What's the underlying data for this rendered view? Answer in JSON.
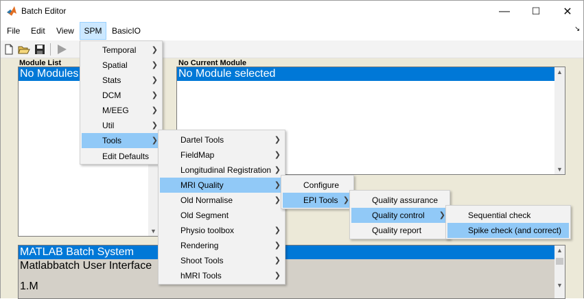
{
  "window": {
    "title": "Batch Editor",
    "controls": {
      "minimize": "—",
      "maximize": "☐",
      "close": "✕"
    }
  },
  "menubar": {
    "items": [
      "File",
      "Edit",
      "View",
      "SPM",
      "BasicIO"
    ],
    "active": "SPM",
    "corner_arrow": "↘"
  },
  "toolbar": {
    "icons": [
      "new-file-icon",
      "open-folder-icon",
      "save-icon",
      "run-icon"
    ]
  },
  "module_list": {
    "label": "Module List",
    "selected_text": "No Modules"
  },
  "current_module": {
    "label": "No Current Module",
    "selected_text": "No Module selected"
  },
  "bottom_panel": {
    "rows": [
      "MATLAB Batch System",
      "Matlabbatch User Interface",
      "1.M"
    ]
  },
  "spm_menu": {
    "items": [
      {
        "label": "Temporal",
        "submenu": true
      },
      {
        "label": "Spatial",
        "submenu": true
      },
      {
        "label": "Stats",
        "submenu": true
      },
      {
        "label": "DCM",
        "submenu": true
      },
      {
        "label": "M/EEG",
        "submenu": true
      },
      {
        "label": "Util",
        "submenu": true
      },
      {
        "label": "Tools",
        "submenu": true,
        "highlighted": true
      },
      {
        "label": "Edit Defaults",
        "submenu": false
      }
    ]
  },
  "tools_menu": {
    "items": [
      {
        "label": "Dartel Tools",
        "submenu": true
      },
      {
        "label": "FieldMap",
        "submenu": true
      },
      {
        "label": "Longitudinal Registration",
        "submenu": true
      },
      {
        "label": "MRI Quality",
        "submenu": true,
        "highlighted": true
      },
      {
        "label": "Old Normalise",
        "submenu": true
      },
      {
        "label": "Old Segment",
        "submenu": false
      },
      {
        "label": "Physio toolbox",
        "submenu": true
      },
      {
        "label": "Rendering",
        "submenu": true
      },
      {
        "label": "Shoot Tools",
        "submenu": true
      },
      {
        "label": "hMRI Tools",
        "submenu": true
      }
    ]
  },
  "mri_quality_menu": {
    "items": [
      {
        "label": "Configure",
        "submenu": false
      },
      {
        "label": "EPI Tools",
        "submenu": true,
        "highlighted": true
      }
    ]
  },
  "epi_tools_menu": {
    "items": [
      {
        "label": "Quality assurance",
        "submenu": false
      },
      {
        "label": "Quality control",
        "submenu": true,
        "highlighted": true
      },
      {
        "label": "Quality report",
        "submenu": false
      }
    ]
  },
  "quality_control_menu": {
    "items": [
      {
        "label": "Sequential check",
        "submenu": false
      },
      {
        "label": "Spike check (and correct)",
        "submenu": false,
        "highlighted": true
      }
    ]
  },
  "colors": {
    "selection": "#0078d7",
    "menu_highlight": "#91c9f7",
    "panel_background": "#ece9d8"
  }
}
